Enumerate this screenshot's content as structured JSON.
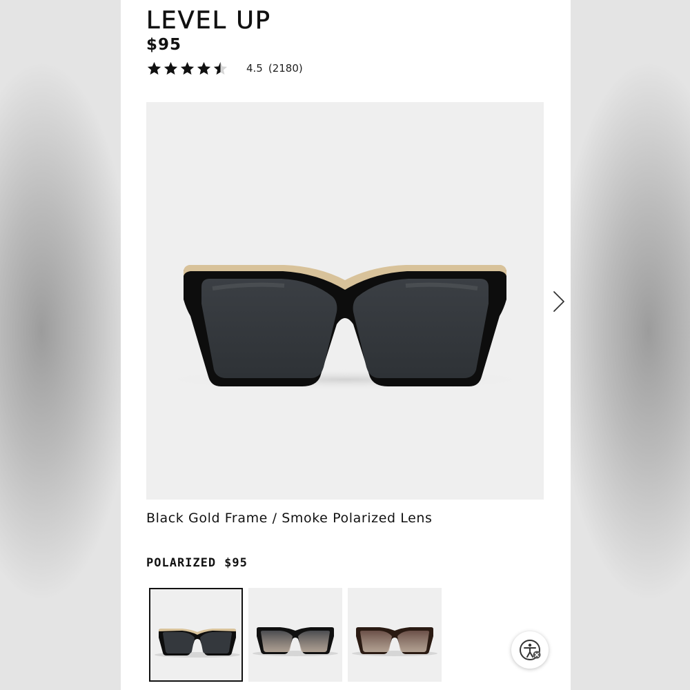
{
  "product": {
    "title": "LEVEL UP",
    "price": "$95",
    "rating": {
      "value": 4.5,
      "value_text": "4.5",
      "count_text": "(2180)",
      "max_stars": 5
    },
    "variant_name": "Black Gold Frame / Smoke Polarized Lens",
    "hero_image": {
      "icon": "sunglasses-black-gold",
      "frame_color": "#0d0d0d",
      "trim_color": "#d8c29a",
      "lens_color": "#3b3f44"
    }
  },
  "carousel": {
    "next_icon": "chevron-right-icon"
  },
  "options": {
    "label": "POLARIZED",
    "price": "$95",
    "swatches": [
      {
        "name": "Black Gold / Smoke",
        "frame_color": "#0d0d0d",
        "lens_color": "#34383d",
        "trim_color": "#d8c29a",
        "selected": true
      },
      {
        "name": "Black / Gradient Smoke",
        "frame_color": "#101010",
        "lens_color": "#4b4c50",
        "trim_color": "#101010",
        "selected": false
      },
      {
        "name": "Tortoise / Brown Fade",
        "frame_color": "#2a1a12",
        "lens_color": "#6b5048",
        "trim_color": "#2a1a12",
        "selected": false
      }
    ]
  },
  "accessibility": {
    "icon": "accessibility-icon"
  }
}
